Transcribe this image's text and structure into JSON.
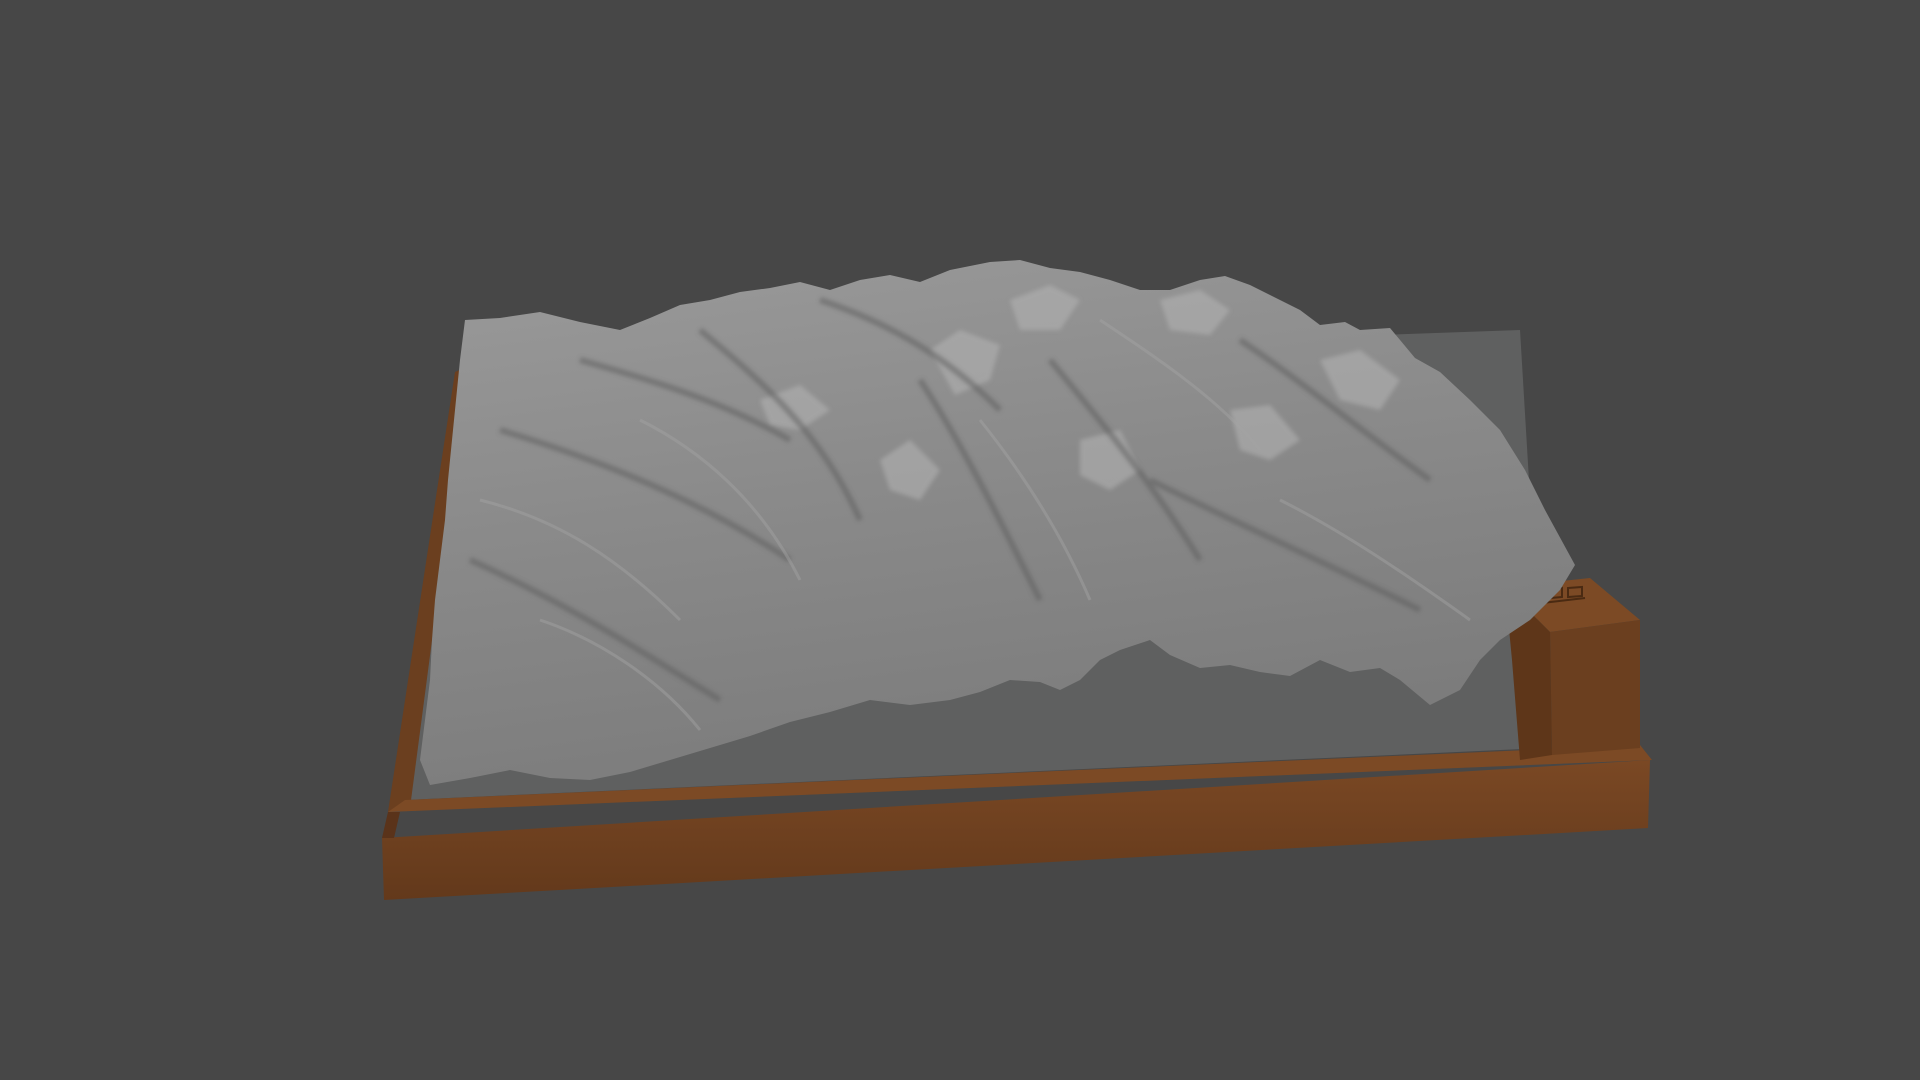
{
  "scene": {
    "background_color": "#474747",
    "object": "terrain-relief-model",
    "colors": {
      "terrain": "#8d8d8d",
      "terrain_highlight": "#b8b8b8",
      "terrain_shadow": "#5e5e5e",
      "base_floor": "#5f6060",
      "frame": "#6b3f1f",
      "frame_light": "#7c4a25",
      "frame_dark": "#4e2d15"
    }
  }
}
